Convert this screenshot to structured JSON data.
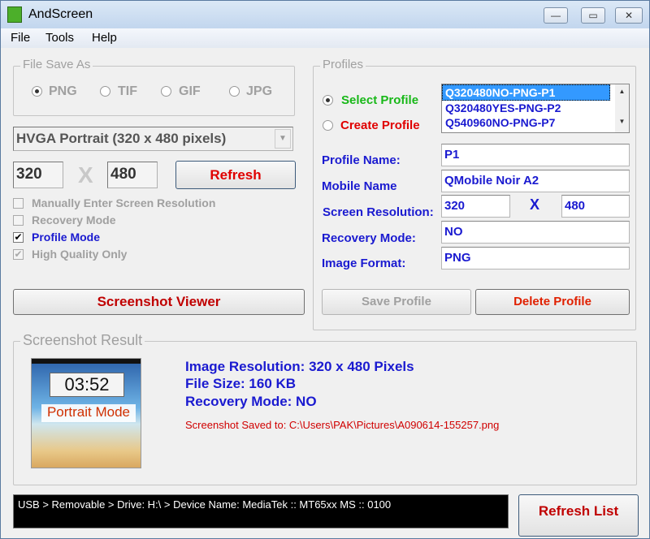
{
  "window": {
    "title": "AndScreen",
    "controls": {
      "minimize": "—",
      "maximize": "▭",
      "close": "✕"
    }
  },
  "menu": [
    "File",
    "Tools",
    "Help"
  ],
  "file_save_as": {
    "label": "File Save As",
    "formats": [
      {
        "label": "PNG",
        "selected": true
      },
      {
        "label": "TIF",
        "selected": false
      },
      {
        "label": "GIF",
        "selected": false
      },
      {
        "label": "JPG",
        "selected": false
      }
    ]
  },
  "resolution_select": "HVGA Portrait (320 x 480 pixels)",
  "width_value": "320",
  "height_value": "480",
  "x_sep": "X",
  "refresh_label": "Refresh",
  "options": [
    {
      "label": "Manually Enter Screen Resolution",
      "checked": false,
      "enabled": false
    },
    {
      "label": "Recovery Mode",
      "checked": false,
      "enabled": false
    },
    {
      "label": "Profile Mode",
      "checked": true,
      "enabled": true
    },
    {
      "label": "High Quality Only",
      "checked": true,
      "enabled": false
    }
  ],
  "screenshot_viewer_label": "Screenshot Viewer",
  "profiles": {
    "label": "Profiles",
    "select_profile": "Select Profile",
    "create_profile": "Create Profile",
    "selected_mode": "select",
    "list": [
      "Q320480NO-PNG-P1",
      "Q320480YES-PNG-P2",
      "Q540960NO-PNG-P7"
    ],
    "list_selected": 0,
    "fields": {
      "profile_name_label": "Profile Name:",
      "profile_name": "P1",
      "mobile_name_label": "Mobile Name",
      "mobile_name": "QMobile Noir A2",
      "screen_res_label": "Screen Resolution:",
      "res_w": "320",
      "res_x": "X",
      "res_h": "480",
      "recovery_label": "Recovery Mode:",
      "recovery": "NO",
      "format_label": "Image Format:",
      "format": "PNG"
    },
    "save_label": "Save Profile",
    "delete_label": "Delete Profile"
  },
  "result": {
    "label": "Screenshot Result",
    "thumb_clock": "03:52",
    "thumb_overlay": "Portrait Mode",
    "resolution": "Image Resolution: 320 x 480 Pixels",
    "file_size": "File Size: 160 KB",
    "recovery": "Recovery Mode: NO",
    "saved": "Screenshot Saved to: C:\\Users\\PAK\\Pictures\\A090614-155257.png"
  },
  "status": "USB > Removable >  Drive: H:\\ >  Device Name: MediaTek :: MT65xx MS :: 0100",
  "refresh_list_label": "Refresh List",
  "colors": {
    "accent_red": "#c00000",
    "label_blue": "#1a1ad0",
    "green": "#18b818"
  }
}
